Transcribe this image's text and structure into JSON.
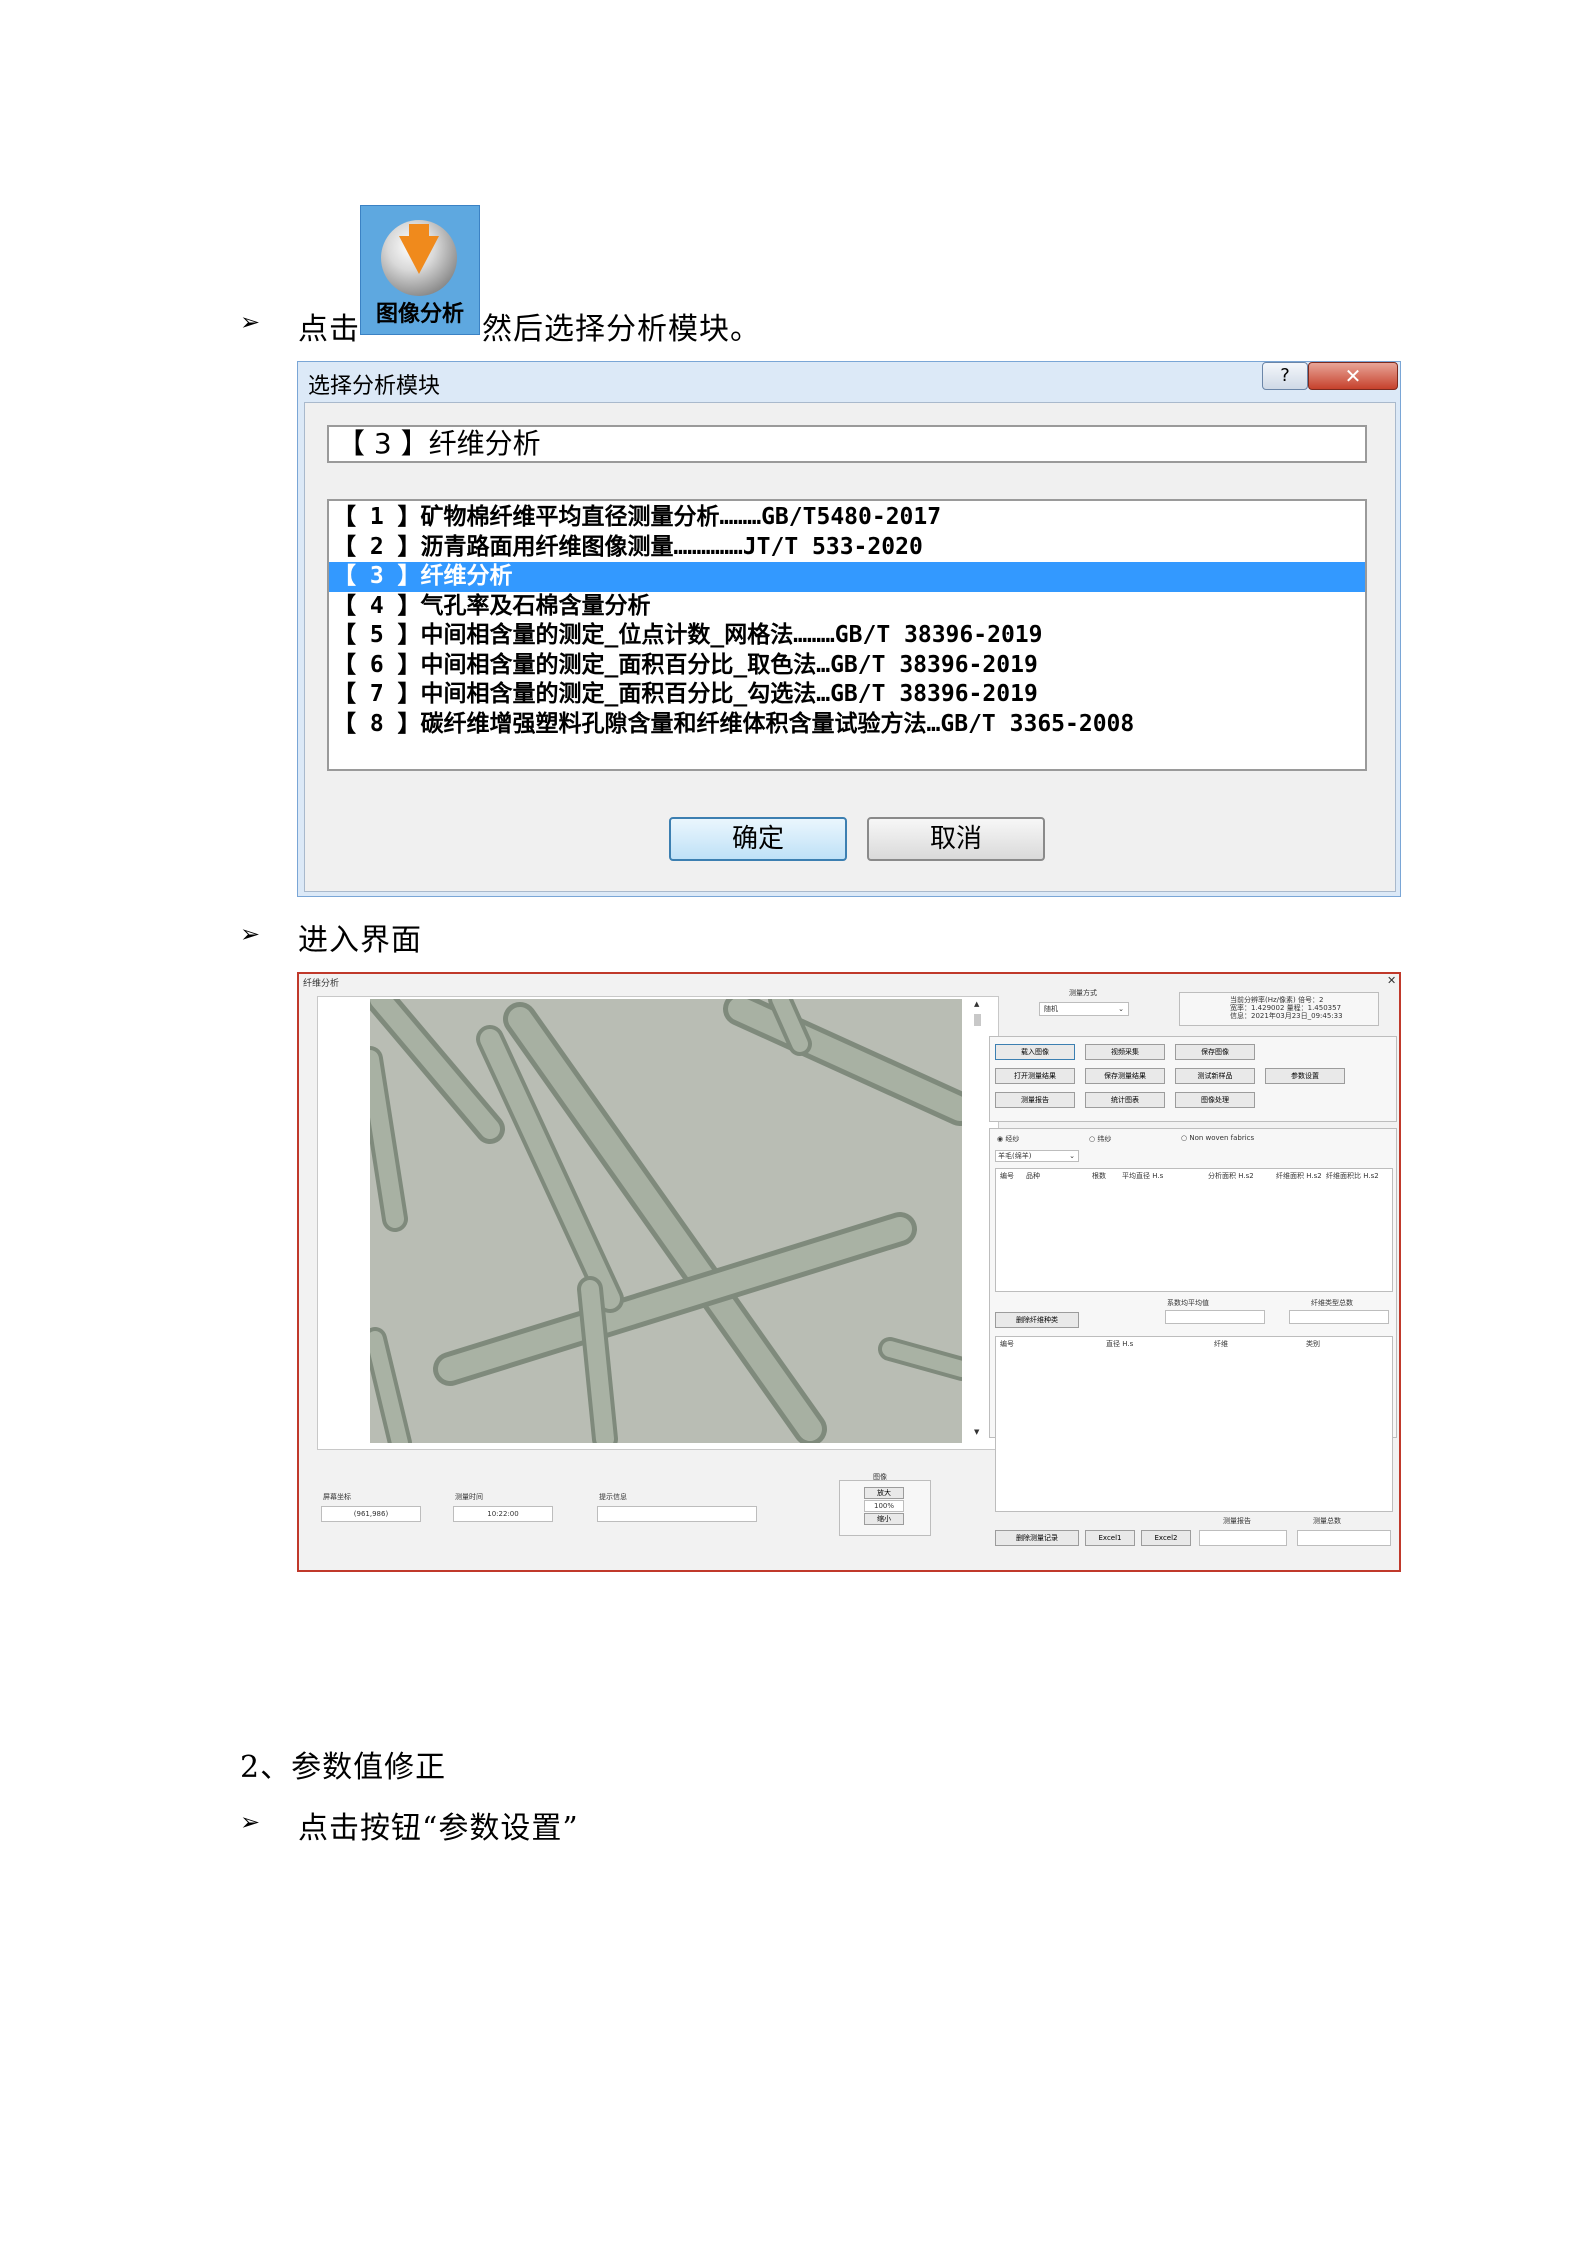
{
  "step_click": {
    "bullet": "➢",
    "prefix": "点击",
    "icon_label": "图像分析",
    "suffix": "然后选择分析模块。"
  },
  "dialog": {
    "title": "选择分析模块",
    "help_label": "?",
    "close_label": "✕",
    "selected_value": "【 3 】纤维分析",
    "items": [
      "【 1 】矿物棉纤维平均直径测量分析………GB/T5480-2017",
      "【 2 】沥青路面用纤维图像测量……………JT/T 533-2020",
      "【 3 】纤维分析",
      "【 4 】气孔率及石棉含量分析",
      "【 5 】中间相含量的测定_位点计数_网格法………GB/T 38396-2019",
      "【 6 】中间相含量的测定_面积百分比_取色法…GB/T 38396-2019",
      "【 7 】中间相含量的测定_面积百分比_勾选法…GB/T 38396-2019",
      "【 8 】碳纤维增强塑料孔隙含量和纤维体积含量试验方法…GB/T 3365-2008"
    ],
    "selected_index": 2,
    "ok_label": "确定",
    "cancel_label": "取消"
  },
  "step_enter": {
    "bullet": "➢",
    "text": "进入界面"
  },
  "app": {
    "title": "纤维分析",
    "close": "✕",
    "measure_mode_label": "测量方式",
    "measure_mode_value": "随机",
    "info_line1": "当前分辨率(Hz/像素)  倍号：2",
    "info_line2": "宽率：1.429002  量程：1.450357",
    "info_line3": "信息：2021年03月23日_09:45:33",
    "buttons_row1": [
      "载入图像",
      "视频采集",
      "保存图像"
    ],
    "buttons_row2": [
      "打开测量结果",
      "保存测量结果",
      "测试新样品",
      "参数设置"
    ],
    "buttons_row3": [
      "测量报告",
      "统计图表",
      "图像处理"
    ],
    "radio_options": [
      "经纱",
      "纬纱",
      "Non woven fabrics"
    ],
    "fiber_type_value": "羊毛(绵羊)",
    "table1_headers": [
      "编号",
      "品种",
      "根数",
      "平均直径 H.s",
      "分析面积 H.s2",
      "纤维面积 H.s2",
      "纤维面积比 H.s2"
    ],
    "avg_label": "系数均平均值",
    "fiber_count_label": "纤维类型总数",
    "delete_fiber_btn": "删除纤维种类",
    "table2_headers": [
      "编号",
      "直径 H.s",
      "纤维",
      "类别"
    ],
    "coord_label": "屏幕坐标",
    "coord_value": "(961,986)",
    "time_label": "测量时间",
    "time_value": "10:22:00",
    "hint_label": "提示信息",
    "image_group_label": "图像",
    "zoom_in": "放大",
    "zoom_value": "100%",
    "zoom_out": "缩小",
    "bottom_buttons": [
      "删除测量记录",
      "Excel1",
      "Excel2"
    ],
    "report_label": "测量报告",
    "total_label": "测量总数"
  },
  "section2": {
    "heading": "2、参数值修正",
    "bullet": "➢",
    "text": "点击按钮“参数设置”"
  },
  "colors": {
    "dialog_frame": "#dce9f7",
    "selection": "#3399ff",
    "app_border": "#c0392b",
    "icon_bg": "#5ea8e0",
    "arrow": "#f08a1c"
  }
}
